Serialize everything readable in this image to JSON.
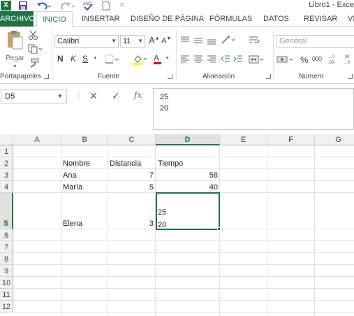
{
  "window": {
    "title": "Libro1 - Exce",
    "logo_text": "X"
  },
  "quick_access": {
    "more": "="
  },
  "tabs": [
    "ARCHIVO",
    "INICIO",
    "INSERTAR",
    "DISEÑO DE PÁGINA",
    "FÓRMULAS",
    "DATOS",
    "REVISAR",
    "VI"
  ],
  "ribbon": {
    "clipboard": {
      "label": "Portapapeles",
      "paste": "Pegar"
    },
    "font": {
      "label": "Fuente",
      "name": "Calibri",
      "size": "11",
      "bold": "N",
      "italic": "K",
      "underline": "S",
      "grow": "A",
      "shrink": "A",
      "color_letter": "A"
    },
    "alignment": {
      "label": "Alineación"
    },
    "number": {
      "label": "Número",
      "format": "General",
      "percent": "%",
      "thousands": "000"
    },
    "colors": {
      "accent": "#217346",
      "font_color": "#e00000",
      "highlight": "#ffff00"
    }
  },
  "formula_bar": {
    "namebox": "D5",
    "lines": [
      "25",
      "20"
    ],
    "fx": "fx"
  },
  "grid": {
    "columns": [
      "A",
      "B",
      "C",
      "D",
      "E",
      "F",
      "G"
    ],
    "selected_column": "D",
    "rows": [
      "1",
      "2",
      "3",
      "4",
      "5",
      "6",
      "7",
      "8",
      "9",
      "10",
      "11",
      "12"
    ],
    "selected_row": "5",
    "cells": {
      "B2": "Nombre",
      "C2": "Distancia",
      "D2": "Tiempo",
      "B3": "Ana",
      "C3": "7",
      "D3": "58",
      "B4": "María",
      "C4": "5",
      "D4": "40",
      "B5": "Elena",
      "C5": "3",
      "D5_line1": "25",
      "D5_line2": "20"
    }
  }
}
